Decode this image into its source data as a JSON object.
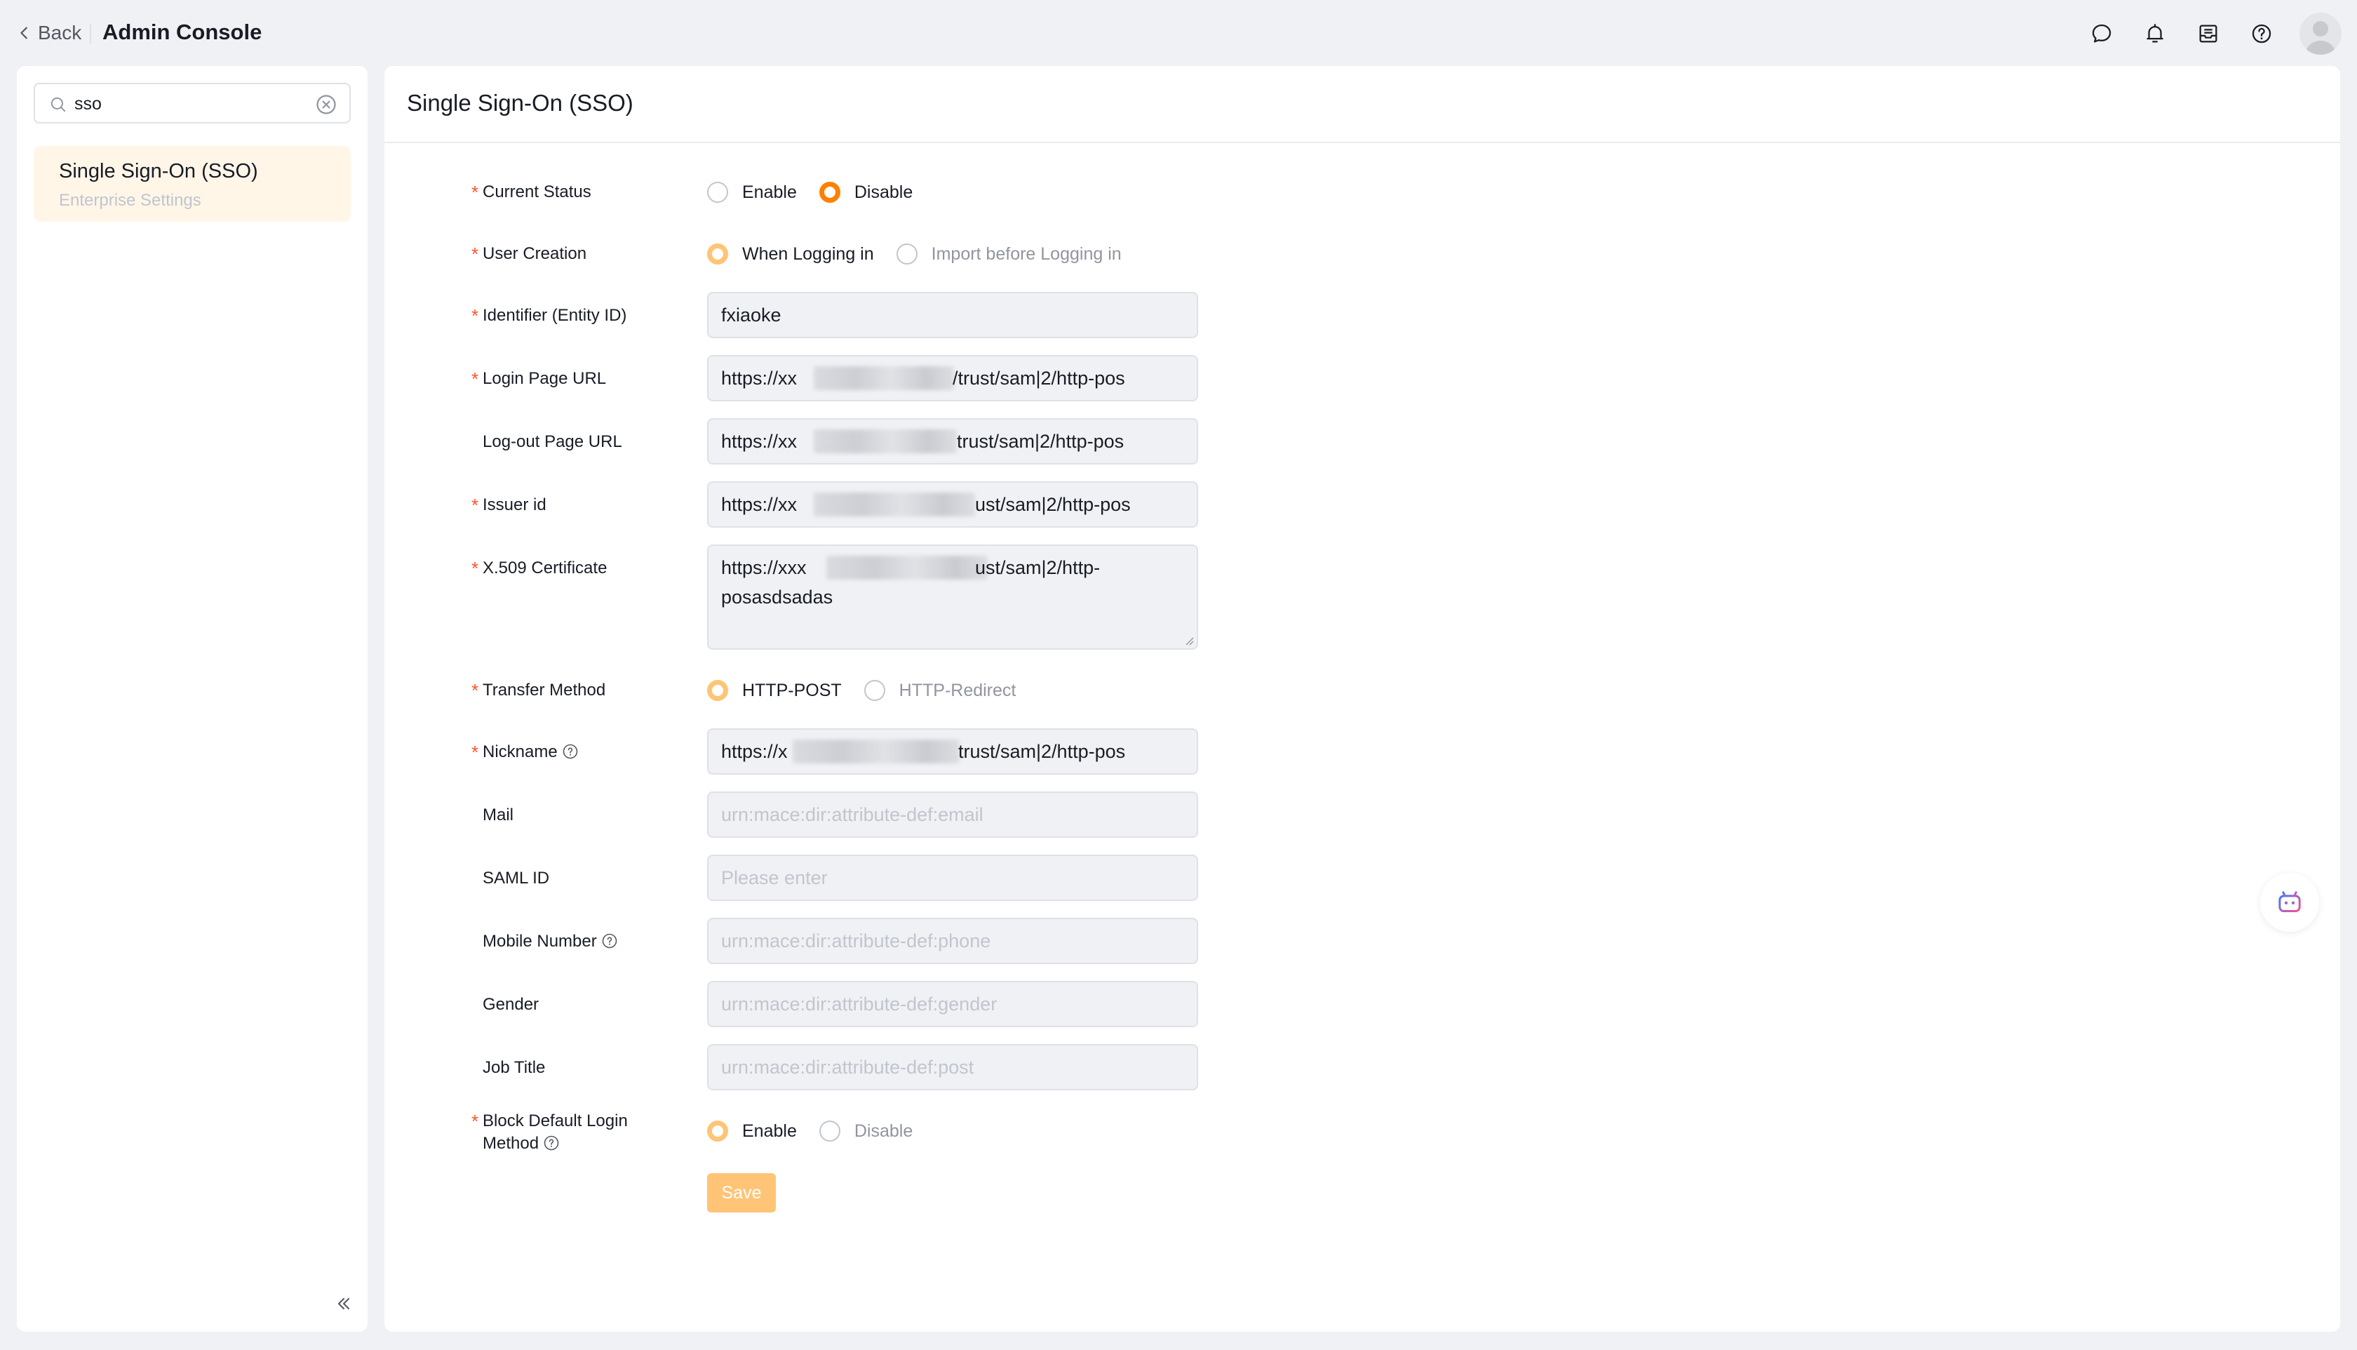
{
  "header": {
    "back_label": "Back",
    "app_title": "Admin Console",
    "icons": [
      "chat-icon",
      "bell-icon",
      "inbox-icon",
      "help-icon",
      "avatar"
    ]
  },
  "sidebar": {
    "search_value": "sso",
    "items": [
      {
        "title": "Single Sign-On (SSO)",
        "subtitle": "Enterprise Settings"
      }
    ]
  },
  "main": {
    "title": "Single Sign-On (SSO)",
    "form": {
      "current_status": {
        "label": "Current Status",
        "options": [
          "Enable",
          "Disable"
        ],
        "selected": "Disable"
      },
      "user_creation": {
        "label": "User Creation",
        "options": [
          "When Logging in",
          "Import before Logging in"
        ],
        "selected": "When Logging in"
      },
      "entity_id": {
        "label": "Identifier (Entity ID)",
        "value": "fxiaoke"
      },
      "login_url": {
        "label": "Login Page URL",
        "value_start": "https://xx",
        "value_end": "/trust/sam|2/http-pos"
      },
      "logout_url": {
        "label": "Log-out Page URL",
        "value_start": "https://xx",
        "value_end": "trust/sam|2/http-pos"
      },
      "issuer_id": {
        "label": "Issuer id",
        "value_start": "https://xx",
        "value_end": "ust/sam|2/http-pos"
      },
      "certificate": {
        "label": "X.509 Certificate",
        "value_start": "https://xxx",
        "value_end": "ust/sam|2/http-",
        "value_line2": "posasdsadas"
      },
      "transfer_method": {
        "label": "Transfer Method",
        "options": [
          "HTTP-POST",
          "HTTP-Redirect"
        ],
        "selected": "HTTP-POST"
      },
      "nickname": {
        "label": "Nickname",
        "value_start": "https://x",
        "value_end": "trust/sam|2/http-pos"
      },
      "mail": {
        "label": "Mail",
        "placeholder": "urn:mace:dir:attribute-def:email"
      },
      "saml_id": {
        "label": "SAML ID",
        "placeholder": "Please enter"
      },
      "mobile": {
        "label": "Mobile Number",
        "placeholder": "urn:mace:dir:attribute-def:phone"
      },
      "gender": {
        "label": "Gender",
        "placeholder": "urn:mace:dir:attribute-def:gender"
      },
      "job_title": {
        "label": "Job Title",
        "placeholder": "urn:mace:dir:attribute-def:post"
      },
      "block_default": {
        "label_line1": "Block Default Login",
        "label_line2": "Method",
        "options": [
          "Enable",
          "Disable"
        ],
        "selected": "Enable"
      },
      "save_label": "Save"
    }
  },
  "colors": {
    "accent": "#ff8000",
    "accent_light": "#ffc475",
    "required": "#ff522a",
    "selected_nav_bg": "#fff6e8"
  }
}
